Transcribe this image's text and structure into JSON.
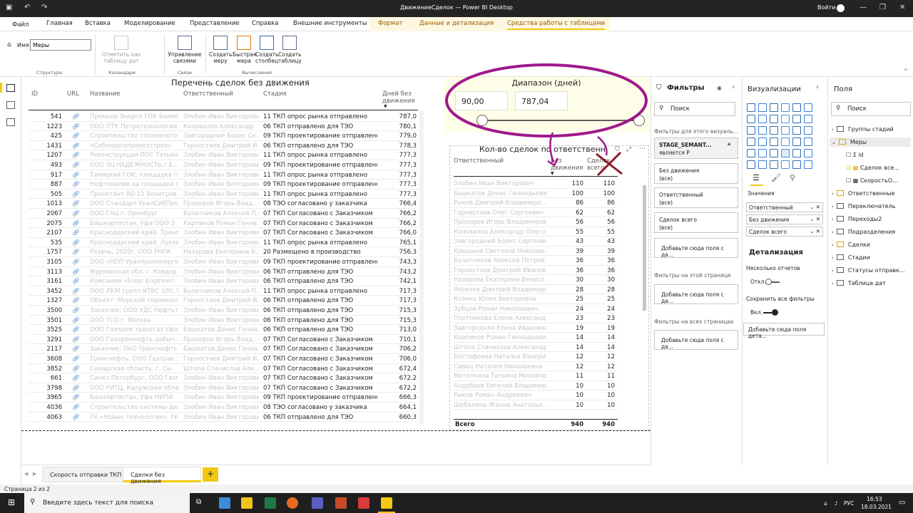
{
  "window": {
    "title": "ДвижениеСделок — Power BI Desktop",
    "signin": "Войти"
  },
  "menu": {
    "file": "Файл",
    "home": "Главная",
    "insert": "Вставка",
    "modeling": "Моделирование",
    "view": "Представление",
    "help": "Справка",
    "external": "Внешние инструменты",
    "format": "Формат",
    "data_drill": "Данные и детализация",
    "table_tools": "Средства работы с таблицами"
  },
  "ribbon": {
    "name_label": "Имя",
    "name_value": "Меры",
    "mark_date_table": "Отметить как таблицу дат",
    "manage_relations": "Управление связями",
    "new_measure": "Создать меру",
    "quick_measure": "Быстрая мера",
    "new_column": "Создать столбец",
    "new_table": "Создать таблицу",
    "groups": {
      "structure": "Структура",
      "calendars": "Календари",
      "relations": "Связи",
      "calculations": "Вычисления"
    }
  },
  "table": {
    "title": "Перечень сделок без движения",
    "headers": {
      "id": "ID",
      "url": "URL",
      "name": "Название",
      "resp": "Ответственный",
      "stage": "Стадия",
      "days": "Дней без движения"
    },
    "rows": [
      {
        "id": "541",
        "name": "Премьер Энерго ГОК Баимск",
        "resp": "Злобин Иван Викторович",
        "stage": "11 ТКП опрос рынка отправлено",
        "days": "787,0"
      },
      {
        "id": "1223",
        "name": "ООО ПТК Петротехнологии",
        "resp": "Коновалов Александр",
        "stage": "06 ТКП отправлено для ТЭО",
        "days": "780,1"
      },
      {
        "id": "425",
        "name": "Строительство топливного",
        "resp": "Завгородний Борис Се...",
        "stage": "09 ТКП проектирование отправлено",
        "days": "779,0"
      },
      {
        "id": "1431",
        "name": "«Сибэнергопроектстроя»",
        "resp": "Горностаев Дмитрий И...",
        "stage": "06 ТКП отправлено для ТЭО",
        "days": "778,3"
      },
      {
        "id": "1207",
        "name": "Реконструкция ППС Татьяна",
        "resp": "Злобин Иван Викторович",
        "stage": "11 ТКП опрос рынка отправлено",
        "days": "777,3"
      },
      {
        "id": "493",
        "name": "ООО ЗЦ НАДЕЖНОСТЬ г.Е...",
        "resp": "Злобин Иван Викторович",
        "stage": "09 ТКП проектирование отправлено",
        "days": "777,3"
      },
      {
        "id": "917",
        "name": "Талицкий ГОК, площадка пр",
        "resp": "Злобин Иван Викторович",
        "stage": "11 ТКП опрос рынка отправлено",
        "days": "777,3"
      },
      {
        "id": "887",
        "name": "Нефтеналив на площадке пр",
        "resp": "Злобин Иван Викторович",
        "stage": "09 ТКП проектирование отправлено",
        "days": "777,3"
      },
      {
        "id": "505",
        "name": "Проектант АО 11 Вохитров",
        "resp": "Злобин Иван Викторович",
        "stage": "11 ТКП опрос рынка отправлено",
        "days": "777,3"
      },
      {
        "id": "1013",
        "name": "ООО Стандарт УралСибПроиСе...",
        "resp": "Прохоров Игорь Влад...",
        "stage": "08 ТЭО согласовано у заказчика",
        "days": "766,4"
      },
      {
        "id": "2067",
        "name": "ООО ГАЦ г. Оренбург",
        "resp": "Булатников Алексей П...",
        "stage": "07 ТКП Согласовано с Заказчиком",
        "days": "766,2"
      },
      {
        "id": "2075",
        "name": "Башкортостан, Уфа ООО З",
        "resp": "Карпиков Роман Генна...",
        "stage": "07 ТКП Согласовано с Заказчиком",
        "days": "766,2"
      },
      {
        "id": "2107",
        "name": "Краснодарский край. Транс",
        "resp": "Злобин Иван Викторович",
        "stage": "07 ТКП Согласовано с Заказчиком",
        "days": "766,0"
      },
      {
        "id": "535",
        "name": "Краснодарский край. Лукой",
        "resp": "Злобин Иван Викторович",
        "stage": "11 ТКП опрос рынка отправлено",
        "days": "765,1"
      },
      {
        "id": "1757",
        "name": "Рязань, 2020г. ООО РНПК",
        "resp": "Назарова Екатерина В...",
        "stage": "20 Размещено в производство",
        "days": "756,3"
      },
      {
        "id": "3105",
        "name": "ООО «НПП Уралпромэнерго»",
        "resp": "Злобин Иван Викторович",
        "stage": "09 ТКП проектирование отправлено",
        "days": "743,3"
      },
      {
        "id": "3113",
        "name": "Мурманская обл. г. Ковдор",
        "resp": "Злобин Иван Викторович",
        "stage": "06 ТКП отправлено для ТЭО",
        "days": "743,2"
      },
      {
        "id": "3161",
        "name": "Компания «Enter Engineeri",
        "resp": "Злобин Иван Викторович",
        "stage": "06 ТКП отправлено для ТЭО",
        "days": "742,1"
      },
      {
        "id": "3452",
        "name": "ООО ЛКМ групп ИТВС 100, У",
        "resp": "Булатников Алексей П...",
        "stage": "11 ТКП опрос рынка отправлено",
        "days": "717,3"
      },
      {
        "id": "1327",
        "name": "Объект: Морской терминал",
        "resp": "Горностаев Дмитрий И...",
        "stage": "06 ТКП отправлено для ТЭО",
        "days": "717,3"
      },
      {
        "id": "3500",
        "name": "Заказчик: ООО УДС Нефтьт",
        "resp": "Злобин Иван Викторович",
        "stage": "06 ТКП отправлено для ТЭО",
        "days": "715,3"
      },
      {
        "id": "3501",
        "name": "ООО ТСО г. Москва",
        "resp": "Злобин Иван Викторович",
        "stage": "06 ТКП отправлено для ТЭО",
        "days": "715,3"
      },
      {
        "id": "3525",
        "name": "ООО Газпром трансгаз Уфа",
        "resp": "Башкатов Денис Генна...",
        "stage": "06 ТКП отправлено для ТЭО",
        "days": "713,0"
      },
      {
        "id": "3291",
        "name": "ООО Газпромнефть добыч...",
        "resp": "Прохоров Игорь Влад...",
        "stage": "07 ТКП Согласовано с Заказчиком",
        "days": "710,1"
      },
      {
        "id": "2117",
        "name": "Заказчик: ПАО Транснефть",
        "resp": "Башкатов Денис Генна...",
        "stage": "07 ТКП Согласовано с Заказчиком",
        "days": "706,2"
      },
      {
        "id": "3608",
        "name": "Транснефть. ООО Газпрак...",
        "resp": "Горностаев Дмитрий И...",
        "stage": "07 ТКП Согласовано с Заказчиком",
        "days": "706,0"
      },
      {
        "id": "3852",
        "name": "Самарская область, г. Сы",
        "resp": "Штопа Станислав Але...",
        "stage": "07 ТКП Согласовано с Заказчиком",
        "days": "672,4"
      },
      {
        "id": "661",
        "name": "Санкт-Петербург, ООО Газп",
        "resp": "Злобин Иван Викторович",
        "stage": "07 ТКП Согласовано с Заказчиком",
        "days": "672,2"
      },
      {
        "id": "3798",
        "name": "ООО РИТЦ, Калужская облас",
        "resp": "Злобин Иван Викторович",
        "stage": "07 ТКП Согласовано с Заказчиком",
        "days": "672,2"
      },
      {
        "id": "3965",
        "name": "Башкортостан, Уфа НИПИ",
        "resp": "Злобин Иван Викторович",
        "stage": "09 ТКП проектирование отправлено",
        "days": "666,3"
      },
      {
        "id": "4036",
        "name": "Строительство системы дих",
        "resp": "Злобин Иван Викторович",
        "stage": "08 ТЭО согласовано у заказчика",
        "days": "664,1"
      },
      {
        "id": "4063",
        "name": "ГК «Новые технологии». Ре",
        "resp": "Злобин Иван Викторович",
        "stage": "06 ТКП отправлено для ТЭО",
        "days": "660,3"
      }
    ]
  },
  "slicer": {
    "title": "Диапазон (дней)",
    "min": "90,00",
    "max": "787,04",
    "range_fraction": [
      0.0,
      1.0
    ]
  },
  "matrix": {
    "title": "Кол-во сделок по ответственн",
    "headers": {
      "resp": "Ответственный",
      "a": "Без движения",
      "b": "Сделок всего"
    },
    "rows": [
      {
        "name": "Злобин Иван Викторович",
        "a": "110",
        "b": "110"
      },
      {
        "name": "Башкатов Денис Геннадьевич",
        "a": "100",
        "b": "100"
      },
      {
        "name": "Рыков Дмитрий Владимиро...",
        "a": "86",
        "b": "86"
      },
      {
        "name": "Горностаев Олег Сергеевич",
        "a": "62",
        "b": "62"
      },
      {
        "name": "Прохоров Игорь Владимиров...",
        "a": "56",
        "b": "56"
      },
      {
        "name": "Коновалов Александр Олего...",
        "a": "55",
        "b": "55"
      },
      {
        "name": "Завгородний Борис Сергеевич",
        "a": "43",
        "a2": "",
        "b": "43"
      },
      {
        "name": "Крыцына Светлана Николае...",
        "a": "39",
        "b": "39"
      },
      {
        "name": "Булатников Алексей Петров...",
        "a": "36",
        "b": "36"
      },
      {
        "name": "Горностаев Дмитрий Иванов...",
        "a": "36",
        "b": "36"
      },
      {
        "name": "Назарова Екатерина Вячесл...",
        "a": "30",
        "b": "30"
      },
      {
        "name": "Яковлев Дмитрий Владимиро...",
        "a": "28",
        "b": "28"
      },
      {
        "name": "Козина Юлия Викторовна",
        "a": "25",
        "b": "25"
      },
      {
        "name": "Зубцов Роман Николаевич",
        "a": "24",
        "b": "24"
      },
      {
        "name": "Плотникова Елена Александ...",
        "a": "23",
        "b": "23"
      },
      {
        "name": "Завгородняя Елена Ивановна",
        "a": "19",
        "b": "19"
      },
      {
        "name": "Карпиков Роман Геннадьевич",
        "a": "14",
        "b": "14"
      },
      {
        "name": "Штопа Станислав Александр...",
        "a": "14",
        "b": "14"
      },
      {
        "name": "Бестофеева Наталья Валери...",
        "a": "12",
        "b": "12"
      },
      {
        "name": "Сивец Наталия Николаевна",
        "a": "12",
        "b": "12"
      },
      {
        "name": "Метелкина Татьяна Михайло...",
        "a": "11",
        "b": "11"
      },
      {
        "name": "Андобаев Евгений Владимир...",
        "a": "10",
        "b": "10"
      },
      {
        "name": "Рыков Роман Андреевич",
        "a": "10",
        "b": "10"
      },
      {
        "name": "Шебалина Жанна Анатолье...",
        "a": "10",
        "b": "10"
      }
    ],
    "total": {
      "label": "Всего",
      "a": "940",
      "b": "940"
    }
  },
  "filters": {
    "title": "Фильтры",
    "search": "Поиск",
    "visual_section": "Фильтры для этого визуаль...",
    "stage_card_title": "STAGE_SEMANT...",
    "stage_card_sub": "является Р",
    "cards": [
      {
        "title": "Без движения",
        "value": "(все)"
      },
      {
        "title": "Ответственный",
        "value": "(все)"
      },
      {
        "title": "Сделок всего",
        "value": "(все)"
      }
    ],
    "add_fields": "Добавьте сюда поля с да...",
    "page_section": "Фильтры на этой странице",
    "all_pages_section": "Фильтры на всех страницах"
  },
  "viz": {
    "title": "Визуализации",
    "values_label": "Значения",
    "wells": [
      "Ответственный",
      "Без движения",
      "Сделок всего"
    ],
    "drill_title": "Детализация",
    "cross_report": "Несколько отчетов",
    "toggle_off": "Откл.",
    "keep_filters": "Сохранить все фильтры",
    "toggle_on": "Вкл.",
    "add_drill": "Добавьте сюда поля дета..."
  },
  "fields": {
    "title": "Поля",
    "search": "Поиск",
    "items": [
      {
        "label": "Группы стадий",
        "kind": "table",
        "indent": 0
      },
      {
        "label": "Меры",
        "kind": "measure-table",
        "indent": 0,
        "expanded": true
      },
      {
        "label": "id",
        "kind": "sigma",
        "indent": 1
      },
      {
        "label": "Сделок все...",
        "kind": "measure-checked",
        "indent": 1
      },
      {
        "label": "СкоростьО...",
        "kind": "measure",
        "indent": 1
      },
      {
        "label": "Ответственные",
        "kind": "table-active",
        "indent": 0
      },
      {
        "label": "Переключатель",
        "kind": "table",
        "indent": 0
      },
      {
        "label": "Переходы2",
        "kind": "table",
        "indent": 0
      },
      {
        "label": "Подразделения",
        "kind": "table",
        "indent": 0
      },
      {
        "label": "Сделки",
        "kind": "table-active",
        "indent": 0
      },
      {
        "label": "Стадии",
        "kind": "table",
        "indent": 0
      },
      {
        "label": "Статусы отправк...",
        "kind": "table",
        "indent": 0
      },
      {
        "label": "Таблица дат",
        "kind": "table",
        "indent": 0
      }
    ]
  },
  "pages": {
    "tabs": [
      "Скорость отправки ТКП",
      "Сделки без движения"
    ],
    "active": 1,
    "add": "+"
  },
  "status": {
    "page": "Страница 2 из 2"
  },
  "taskbar": {
    "search": "Введите здесь текст для поиска",
    "lang": "РУС",
    "time": "16:53",
    "date": "18.03.2021"
  },
  "colors": {
    "accent": "#f2c811",
    "annotation": "#a0198b",
    "annotation_x": "#8b1a2b",
    "table_arrow": "#8b1a2b"
  }
}
